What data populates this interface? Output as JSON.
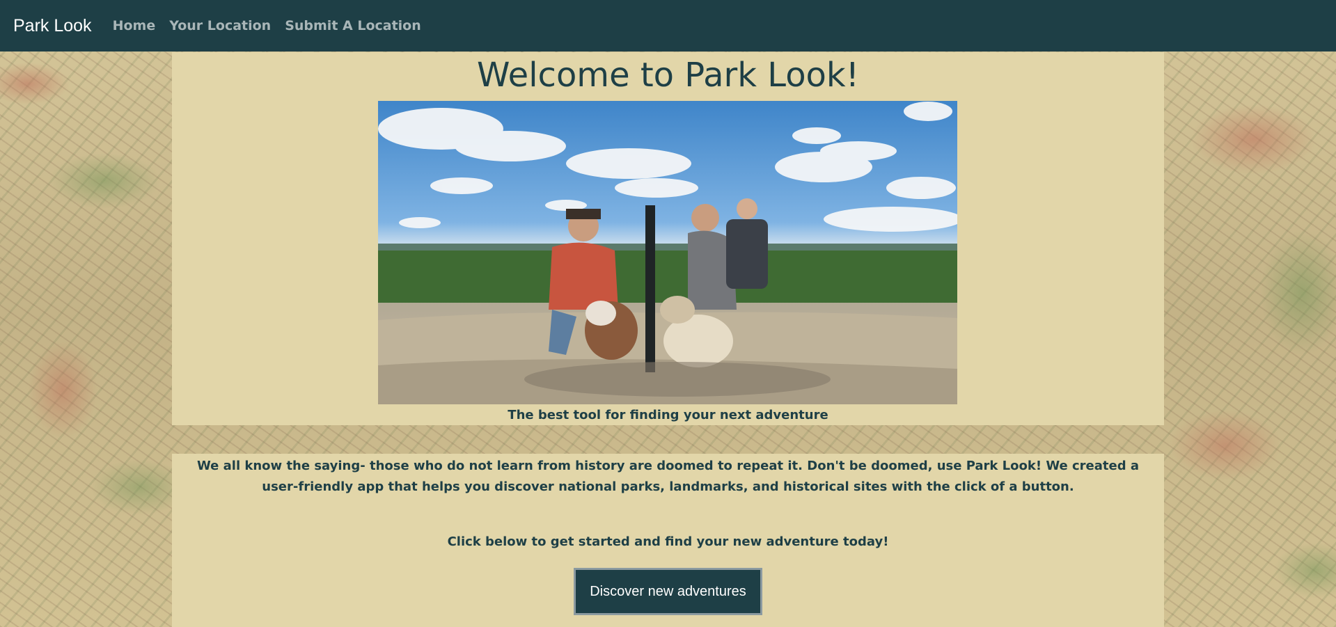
{
  "navbar": {
    "brand": "Park Look",
    "links": [
      "Home",
      "Your Location",
      "Submit A Location"
    ]
  },
  "hero": {
    "title": "Welcome to Park Look!",
    "caption": "The best tool for finding your next adventure"
  },
  "content": {
    "intro": "We all know the saying- those who do not learn from history are doomed to repeat it. Don't be doomed, use Park Look! We created a user-friendly app that helps you discover national parks, landmarks, and historical sites with the click of a button.",
    "cta_text": "Click below to get started and find your new adventure today!",
    "cta_button": "Discover new adventures"
  },
  "colors": {
    "navbar": "#1e3f46",
    "panel": "#e2d6a9",
    "text": "#1e3f46",
    "button": "#1e3f46"
  }
}
